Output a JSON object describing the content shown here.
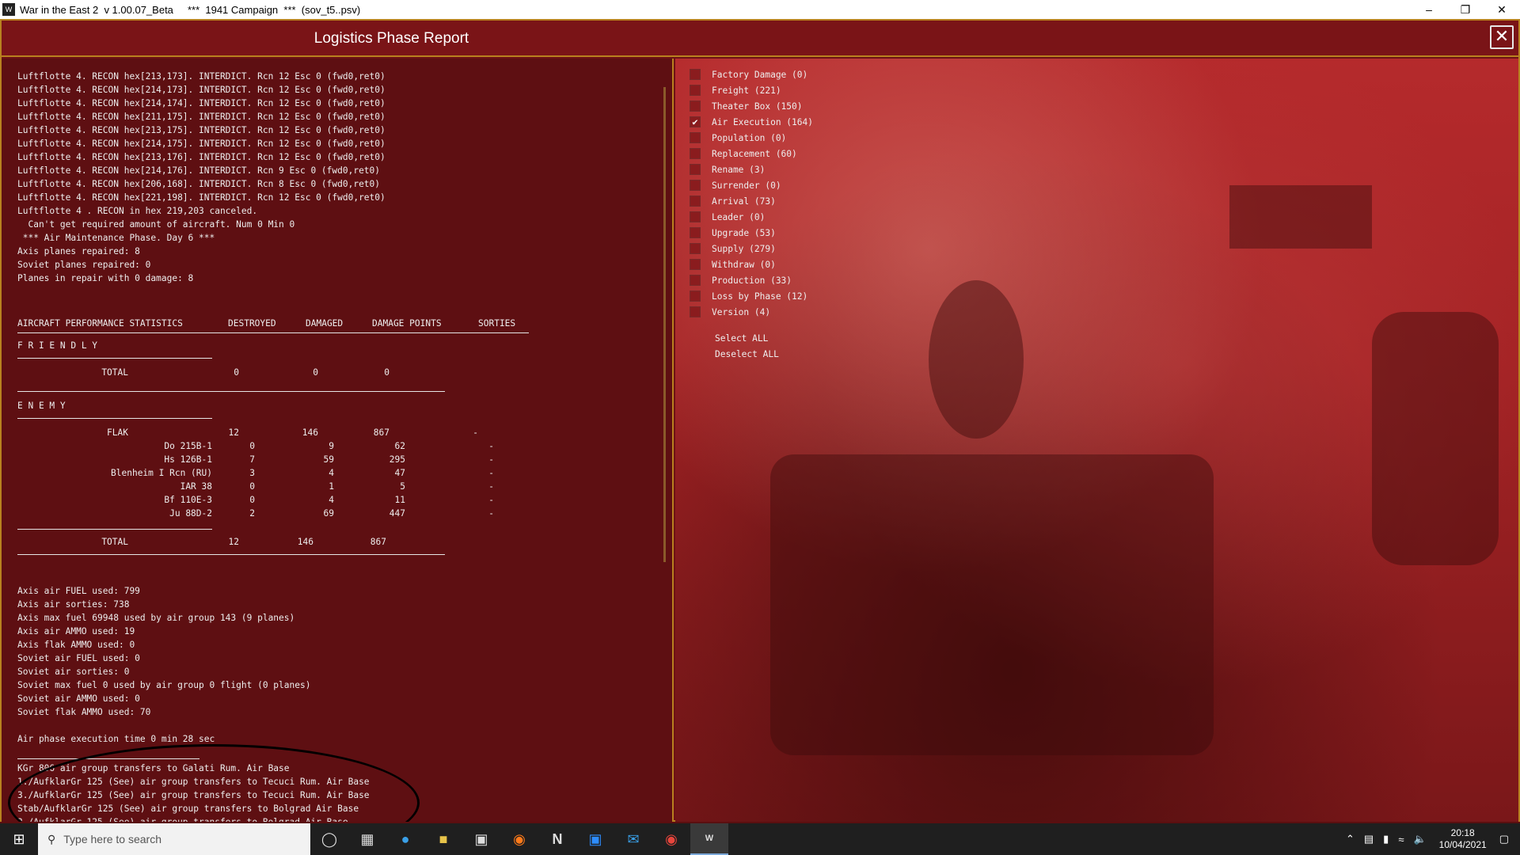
{
  "window": {
    "title": "War in the East 2  v 1.00.07_Beta     ***  1941 Campaign  ***  (sov_t5..psv)"
  },
  "header": {
    "title": "Logistics Phase Report"
  },
  "log_lines": [
    "Luftflotte 4. RECON hex[213,173]. INTERDICT. Rcn 12 Esc 0 (fwd0,ret0)",
    "Luftflotte 4. RECON hex[214,173]. INTERDICT. Rcn 12 Esc 0 (fwd0,ret0)",
    "Luftflotte 4. RECON hex[214,174]. INTERDICT. Rcn 12 Esc 0 (fwd0,ret0)",
    "Luftflotte 4. RECON hex[211,175]. INTERDICT. Rcn 12 Esc 0 (fwd0,ret0)",
    "Luftflotte 4. RECON hex[213,175]. INTERDICT. Rcn 12 Esc 0 (fwd0,ret0)",
    "Luftflotte 4. RECON hex[214,175]. INTERDICT. Rcn 12 Esc 0 (fwd0,ret0)",
    "Luftflotte 4. RECON hex[213,176]. INTERDICT. Rcn 12 Esc 0 (fwd0,ret0)",
    "Luftflotte 4. RECON hex[214,176]. INTERDICT. Rcn 9 Esc 0 (fwd0,ret0)",
    "Luftflotte 4. RECON hex[206,168]. INTERDICT. Rcn 8 Esc 0 (fwd0,ret0)",
    "Luftflotte 4. RECON hex[221,198]. INTERDICT. Rcn 12 Esc 0 (fwd0,ret0)",
    "Luftflotte 4 . RECON in hex 219,203 canceled.",
    "  Can't get required amount of aircraft. Num 0 Min 0",
    " *** Air Maintenance Phase. Day 6 ***",
    "Axis planes repaired: 8",
    "Soviet planes repaired: 0",
    "Planes in repair with 0 damage: 8"
  ],
  "stats": {
    "header": [
      "AIRCRAFT PERFORMANCE STATISTICS",
      "DESTROYED",
      "DAMAGED",
      "DAMAGE POINTS",
      "SORTIES"
    ],
    "friendly_label": "F R I E N D L Y",
    "friendly_total": {
      "label": "TOTAL",
      "destroyed": "0",
      "damaged": "0",
      "points": "0"
    },
    "enemy_label": "E N E M Y",
    "flak": {
      "label": "FLAK",
      "destroyed": "12",
      "damaged": "146",
      "points": "867",
      "sorties": "-"
    },
    "aircraft": [
      {
        "name": "Do 215B-1",
        "destroyed": "0",
        "damaged": "9",
        "points": "62",
        "sorties": "-"
      },
      {
        "name": "Hs 126B-1",
        "destroyed": "7",
        "damaged": "59",
        "points": "295",
        "sorties": "-"
      },
      {
        "name": "Blenheim I Rcn (RU)",
        "destroyed": "3",
        "damaged": "4",
        "points": "47",
        "sorties": "-"
      },
      {
        "name": "IAR 38",
        "destroyed": "0",
        "damaged": "1",
        "points": "5",
        "sorties": "-"
      },
      {
        "name": "Bf 110E-3",
        "destroyed": "0",
        "damaged": "4",
        "points": "11",
        "sorties": "-"
      },
      {
        "name": "Ju 88D-2",
        "destroyed": "2",
        "damaged": "69",
        "points": "447",
        "sorties": "-"
      }
    ],
    "enemy_total": {
      "label": "TOTAL",
      "destroyed": "12",
      "damaged": "146",
      "points": "867"
    }
  },
  "summary_lines": [
    "Axis air FUEL used: 799",
    "Axis air sorties: 738",
    "Axis max fuel 69948 used by air group 143 (9 planes)",
    "Axis air AMMO used: 19",
    "Axis flak AMMO used: 0",
    "Soviet air FUEL used: 0",
    "Soviet air sorties: 0",
    "Soviet max fuel 0 used by air group 0 flight (0 planes)",
    "Soviet air AMMO used: 0",
    "Soviet flak AMMO used: 70",
    "",
    "Air phase execution time 0 min 28 sec"
  ],
  "transfer_lines": [
    "KGr 806 air group transfers to Galati Rum. Air Base",
    "1./AufklarGr 125 (See) air group transfers to Tecuci Rum. Air Base",
    "3./AufklarGr 125 (See) air group transfers to Tecuci Rum. Air Base",
    "Stab/AufklarGr 125 (See) air group transfers to Bolgrad Air Base",
    "2./AufklarGr 125 (See) air group transfers to Bolgrad Air Base"
  ],
  "filters": [
    {
      "label": "Factory Damage  (0)",
      "checked": false
    },
    {
      "label": "Freight  (221)",
      "checked": false
    },
    {
      "label": "Theater Box  (150)",
      "checked": false
    },
    {
      "label": "Air Execution  (164)",
      "checked": true
    },
    {
      "label": "Population  (0)",
      "checked": false
    },
    {
      "label": "Replacement  (60)",
      "checked": false
    },
    {
      "label": "Rename  (3)",
      "checked": false
    },
    {
      "label": "Surrender  (0)",
      "checked": false
    },
    {
      "label": "Arrival  (73)",
      "checked": false
    },
    {
      "label": "Leader  (0)",
      "checked": false
    },
    {
      "label": "Upgrade  (53)",
      "checked": false
    },
    {
      "label": "Supply  (279)",
      "checked": false
    },
    {
      "label": "Withdraw  (0)",
      "checked": false
    },
    {
      "label": "Production  (33)",
      "checked": false
    },
    {
      "label": "Loss by Phase  (12)",
      "checked": false
    },
    {
      "label": "Version  (4)",
      "checked": false
    }
  ],
  "select_all": "Select ALL",
  "deselect_all": "Deselect ALL",
  "taskbar": {
    "search_placeholder": "Type here to search",
    "time": "20:18",
    "date": "10/04/2021"
  }
}
